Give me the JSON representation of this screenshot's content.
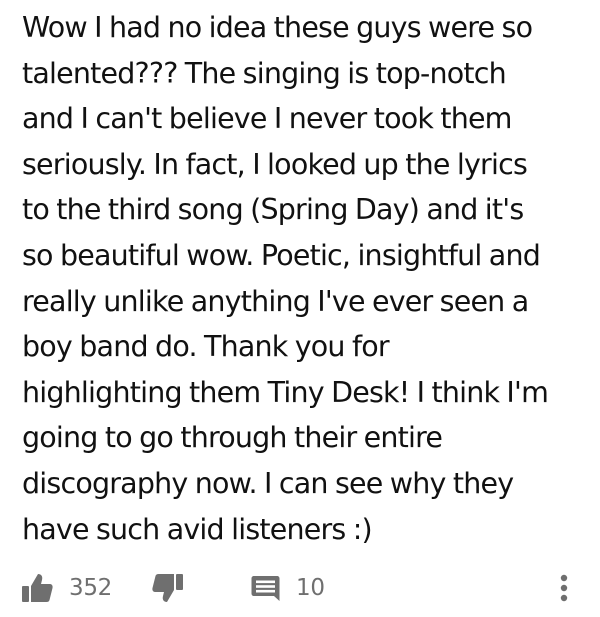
{
  "comment": {
    "lines": [
      "Wow I had no idea these guys were so",
      "talented??? The singing is top-notch",
      "and I can't believe I never took them",
      "seriously. In fact, I looked up the lyrics",
      "to the third song (Spring Day) and it's",
      "so beautiful wow. Poetic, insightful and",
      "really unlike anything I've ever seen a",
      "boy band do. Thank you for",
      "highlighting them Tiny Desk! I think I'm",
      "going to go through their entire",
      "discography now. I can see why they",
      "have such avid listeners :)"
    ]
  },
  "actions": {
    "likes": "352",
    "replies": "10",
    "icons": {
      "like": "thumbs-up-icon",
      "dislike": "thumbs-down-icon",
      "reply": "comment-icon",
      "more": "more-vertical-icon"
    }
  },
  "colors": {
    "text": "#111111",
    "count": "#6f6f6f",
    "icon": "#6f6f6f",
    "background": "#ffffff"
  }
}
